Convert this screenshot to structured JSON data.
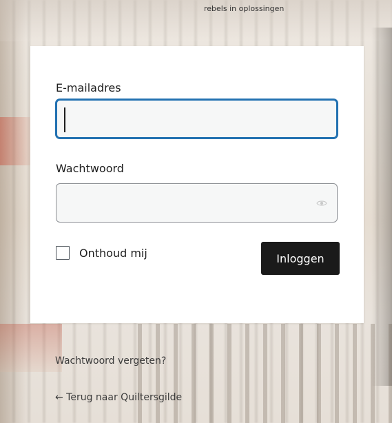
{
  "header": {
    "tagline": "rebels in oplossingen"
  },
  "login_form": {
    "email_label": "E-mailadres",
    "email_value": "",
    "password_label": "Wachtwoord",
    "password_value": "",
    "remember_label": "Onthoud mij",
    "remember_checked": false,
    "submit_label": "Inloggen",
    "show_password_icon": "eye-icon"
  },
  "links": {
    "forgot_password": "Wachtwoord vergeten?",
    "back_to_site": "← Terug naar Quiltersgilde"
  },
  "colors": {
    "focus_border": "#2271b1",
    "button_bg": "#1a1a1a",
    "button_text": "#ffffff"
  }
}
